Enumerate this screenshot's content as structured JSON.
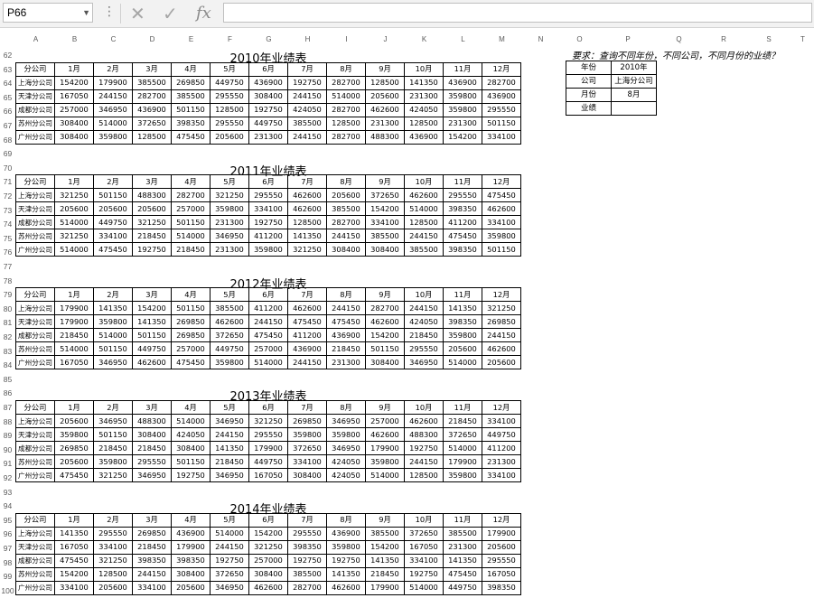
{
  "formula_bar": {
    "name_box": "P66",
    "cancel_icon": "✕",
    "confirm_icon": "✓",
    "fx_label": "fx",
    "formula": ""
  },
  "columns": [
    "A",
    "B",
    "C",
    "D",
    "E",
    "F",
    "G",
    "H",
    "I",
    "J",
    "K",
    "L",
    "M",
    "N",
    "O",
    "P",
    "Q",
    "R",
    "S",
    "T"
  ],
  "tables": [
    {
      "title": "2010年业绩表",
      "rows": [
        62,
        63,
        64,
        65,
        66,
        67,
        68
      ],
      "header": [
        "分公司",
        "1月",
        "2月",
        "3月",
        "4月",
        "5月",
        "6月",
        "7月",
        "8月",
        "9月",
        "10月",
        "11月",
        "12月"
      ],
      "data": [
        [
          "上海分公司",
          "154200",
          "179900",
          "385500",
          "269850",
          "449750",
          "436900",
          "192750",
          "282700",
          "128500",
          "141350",
          "436900",
          "282700"
        ],
        [
          "天津分公司",
          "167050",
          "244150",
          "282700",
          "385500",
          "295550",
          "308400",
          "244150",
          "514000",
          "205600",
          "231300",
          "359800",
          "436900"
        ],
        [
          "成都分公司",
          "257000",
          "346950",
          "436900",
          "501150",
          "128500",
          "192750",
          "424050",
          "282700",
          "462600",
          "424050",
          "359800",
          "295550"
        ],
        [
          "苏州分公司",
          "308400",
          "514000",
          "372650",
          "398350",
          "295550",
          "449750",
          "385500",
          "128500",
          "231300",
          "128500",
          "231300",
          "501150"
        ],
        [
          "广州分公司",
          "308400",
          "359800",
          "128500",
          "475450",
          "205600",
          "231300",
          "244150",
          "282700",
          "488300",
          "436900",
          "154200",
          "334100"
        ]
      ]
    },
    {
      "title": "2011年业绩表",
      "rows": [
        69,
        70,
        71,
        72,
        73,
        74,
        75,
        76
      ],
      "header": [
        "分公司",
        "1月",
        "2月",
        "3月",
        "4月",
        "5月",
        "6月",
        "7月",
        "8月",
        "9月",
        "10月",
        "11月",
        "12月"
      ],
      "data": [
        [
          "上海分公司",
          "321250",
          "501150",
          "488300",
          "282700",
          "321250",
          "295550",
          "462600",
          "205600",
          "372650",
          "462600",
          "295550",
          "475450"
        ],
        [
          "天津分公司",
          "205600",
          "205600",
          "205600",
          "257000",
          "359800",
          "334100",
          "462600",
          "385500",
          "154200",
          "514000",
          "398350",
          "462600"
        ],
        [
          "成都分公司",
          "514000",
          "449750",
          "321250",
          "501150",
          "231300",
          "192750",
          "128500",
          "282700",
          "334100",
          "128500",
          "411200",
          "334100"
        ],
        [
          "苏州分公司",
          "321250",
          "334100",
          "218450",
          "514000",
          "346950",
          "411200",
          "141350",
          "244150",
          "385500",
          "244150",
          "475450",
          "359800"
        ],
        [
          "广州分公司",
          "514000",
          "475450",
          "192750",
          "218450",
          "231300",
          "359800",
          "321250",
          "308400",
          "308400",
          "385500",
          "398350",
          "501150"
        ]
      ]
    },
    {
      "title": "2012年业绩表",
      "rows": [
        77,
        78,
        79,
        80,
        81,
        82,
        83,
        84
      ],
      "header": [
        "分公司",
        "1月",
        "2月",
        "3月",
        "4月",
        "5月",
        "6月",
        "7月",
        "8月",
        "9月",
        "10月",
        "11月",
        "12月"
      ],
      "data": [
        [
          "上海分公司",
          "179900",
          "141350",
          "154200",
          "501150",
          "385500",
          "411200",
          "462600",
          "244150",
          "282700",
          "244150",
          "141350",
          "321250"
        ],
        [
          "天津分公司",
          "179900",
          "359800",
          "141350",
          "269850",
          "462600",
          "244150",
          "475450",
          "475450",
          "462600",
          "424050",
          "398350",
          "269850"
        ],
        [
          "成都分公司",
          "218450",
          "514000",
          "501150",
          "269850",
          "372650",
          "475450",
          "411200",
          "436900",
          "154200",
          "218450",
          "359800",
          "244150"
        ],
        [
          "苏州分公司",
          "514000",
          "501150",
          "449750",
          "257000",
          "449750",
          "257000",
          "436900",
          "218450",
          "501150",
          "295550",
          "205600",
          "462600"
        ],
        [
          "广州分公司",
          "167050",
          "346950",
          "462600",
          "475450",
          "359800",
          "514000",
          "244150",
          "231300",
          "308400",
          "346950",
          "514000",
          "205600"
        ]
      ]
    },
    {
      "title": "2013年业绩表",
      "rows": [
        85,
        86,
        87,
        88,
        89,
        90,
        91,
        92
      ],
      "header": [
        "分公司",
        "1月",
        "2月",
        "3月",
        "4月",
        "5月",
        "6月",
        "7月",
        "8月",
        "9月",
        "10月",
        "11月",
        "12月"
      ],
      "data": [
        [
          "上海分公司",
          "205600",
          "346950",
          "488300",
          "514000",
          "346950",
          "321250",
          "269850",
          "346950",
          "257000",
          "462600",
          "218450",
          "334100"
        ],
        [
          "天津分公司",
          "359800",
          "501150",
          "308400",
          "424050",
          "244150",
          "295550",
          "359800",
          "359800",
          "462600",
          "488300",
          "372650",
          "449750"
        ],
        [
          "成都分公司",
          "269850",
          "218450",
          "218450",
          "308400",
          "141350",
          "179900",
          "372650",
          "346950",
          "179900",
          "192750",
          "514000",
          "411200"
        ],
        [
          "苏州分公司",
          "205600",
          "359800",
          "295550",
          "501150",
          "218450",
          "449750",
          "334100",
          "424050",
          "359800",
          "244150",
          "179900",
          "231300"
        ],
        [
          "广州分公司",
          "475450",
          "321250",
          "346950",
          "192750",
          "346950",
          "167050",
          "308400",
          "424050",
          "514000",
          "128500",
          "359800",
          "334100"
        ]
      ]
    },
    {
      "title": "2014年业绩表",
      "rows": [
        93,
        94,
        95,
        96,
        97,
        98,
        99,
        100
      ],
      "header": [
        "分公司",
        "1月",
        "2月",
        "3月",
        "4月",
        "5月",
        "6月",
        "7月",
        "8月",
        "9月",
        "10月",
        "11月",
        "12月"
      ],
      "data": [
        [
          "上海分公司",
          "141350",
          "295550",
          "269850",
          "436900",
          "514000",
          "154200",
          "295550",
          "436900",
          "385500",
          "372650",
          "385500",
          "179900"
        ],
        [
          "天津分公司",
          "167050",
          "334100",
          "218450",
          "179900",
          "244150",
          "321250",
          "398350",
          "359800",
          "154200",
          "167050",
          "231300",
          "205600"
        ],
        [
          "成都分公司",
          "475450",
          "321250",
          "398350",
          "398350",
          "192750",
          "257000",
          "192750",
          "192750",
          "141350",
          "334100",
          "141350",
          "295550"
        ],
        [
          "苏州分公司",
          "154200",
          "128500",
          "244150",
          "308400",
          "372650",
          "308400",
          "385500",
          "141350",
          "218450",
          "192750",
          "475450",
          "167050"
        ],
        [
          "广州分公司",
          "334100",
          "205600",
          "334100",
          "205600",
          "346950",
          "462600",
          "282700",
          "462600",
          "179900",
          "514000",
          "449750",
          "398350"
        ]
      ]
    }
  ],
  "query": {
    "note": "要求：查询不同年份，不同公司，不同月份的业绩？",
    "rows": [
      {
        "label": "年份",
        "value": "2010年"
      },
      {
        "label": "公司",
        "value": "上海分公司"
      },
      {
        "label": "月份",
        "value": "8月"
      },
      {
        "label": "业绩",
        "value": ""
      }
    ]
  }
}
